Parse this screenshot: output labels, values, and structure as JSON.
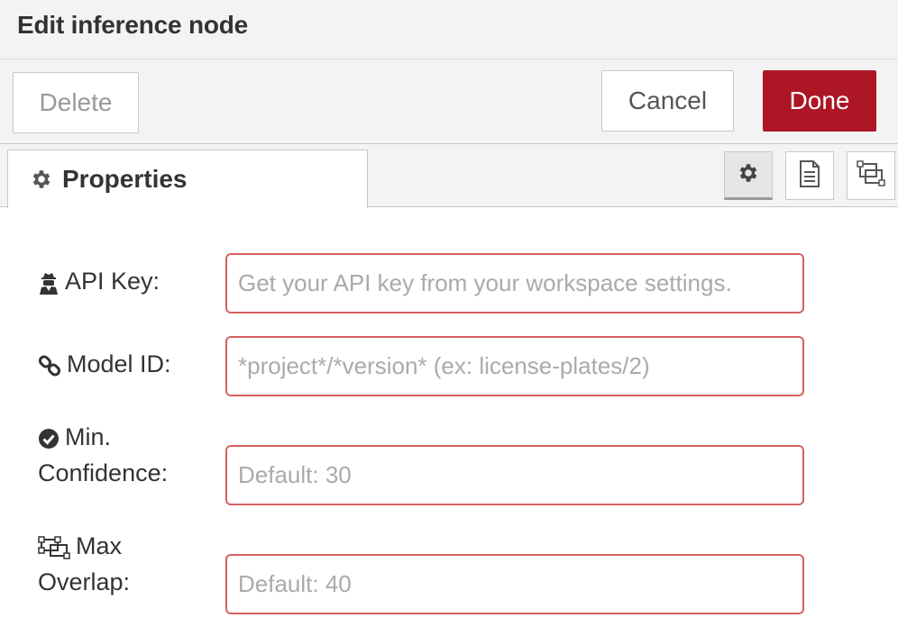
{
  "header": {
    "title": "Edit inference node"
  },
  "toolbar": {
    "delete_label": "Delete",
    "cancel_label": "Cancel",
    "done_label": "Done"
  },
  "tabs": [
    {
      "label": "Properties",
      "icon": "gear-icon",
      "active": true
    }
  ],
  "side_buttons": [
    {
      "icon": "gear-icon",
      "active": true
    },
    {
      "icon": "document-icon",
      "active": false
    },
    {
      "icon": "appearance-icon",
      "active": false
    }
  ],
  "fields": [
    {
      "label": "API Key:",
      "icon": "user-secret-icon",
      "value": "",
      "placeholder": "Get your API key from your workspace settings."
    },
    {
      "label": "Model ID:",
      "icon": "link-icon",
      "value": "",
      "placeholder": "*project*/*version* (ex: license-plates/2)"
    },
    {
      "label_line1": "Min.",
      "label_line2": "Confidence:",
      "icon": "check-circle-icon",
      "value": "",
      "placeholder": "Default: 30"
    },
    {
      "label_line1": "Max",
      "label_line2": "Overlap:",
      "icon": "object-ungroup-icon",
      "value": "",
      "placeholder": "Default: 40"
    }
  ],
  "colors": {
    "accent": "#ad1625",
    "field_border": "#d6615f",
    "panel_bg": "#f3f3f3"
  }
}
